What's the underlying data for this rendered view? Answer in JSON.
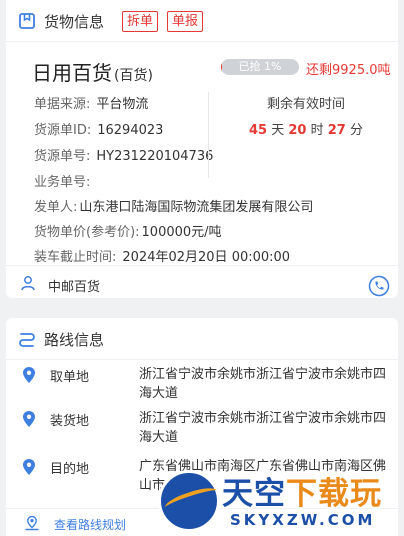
{
  "goods_section": {
    "title": "货物信息",
    "tags": [
      "拆单",
      "单报"
    ],
    "name": "日用百货",
    "type": "(百货)",
    "grabbed_text": "已抢 1%",
    "grabbed_fraction": 0.01,
    "remaining": "还剩9925.0吨",
    "details": [
      {
        "label": "单据来源:",
        "value": "平台物流"
      },
      {
        "label": "货源单ID:",
        "value": "16294023"
      },
      {
        "label": "货源单号:",
        "value": "HY231220104736"
      },
      {
        "label": "业务单号:",
        "value": ""
      },
      {
        "label": "发单人:",
        "value": "山东港口陆海国际物流集团发展有限公司"
      },
      {
        "label": "货物单价(参考价):",
        "value": "100000元/吨"
      },
      {
        "label": "装车截止时间:",
        "value": "2024年02月20日 00:00:00"
      }
    ],
    "validity": {
      "title": "剩余有效时间",
      "days": "45",
      "day_unit": "天",
      "hours": "20",
      "hour_unit": "时",
      "minutes": "27",
      "minute_unit": "分"
    },
    "contact": "中邮百货"
  },
  "route_section": {
    "title": "路线信息",
    "stops": [
      {
        "label": "取单地",
        "address": "浙江省宁波市余姚市浙江省宁波市余姚市四海大道"
      },
      {
        "label": "装货地",
        "address": "浙江省宁波市余姚市浙江省宁波市余姚市四海大道"
      },
      {
        "label": "目的地",
        "address": "广东省佛山市南海区广东省佛山市南海区佛山市"
      }
    ],
    "plan_link": "查看路线规划"
  },
  "watermark": {
    "title_main": "天空",
    "title_accent": "下载玩",
    "domain": "SKYXZW.COM"
  },
  "colors": {
    "accent_red": "#e53935",
    "link_blue": "#3f7fe0",
    "icon_blue": "#3f7fe0"
  }
}
